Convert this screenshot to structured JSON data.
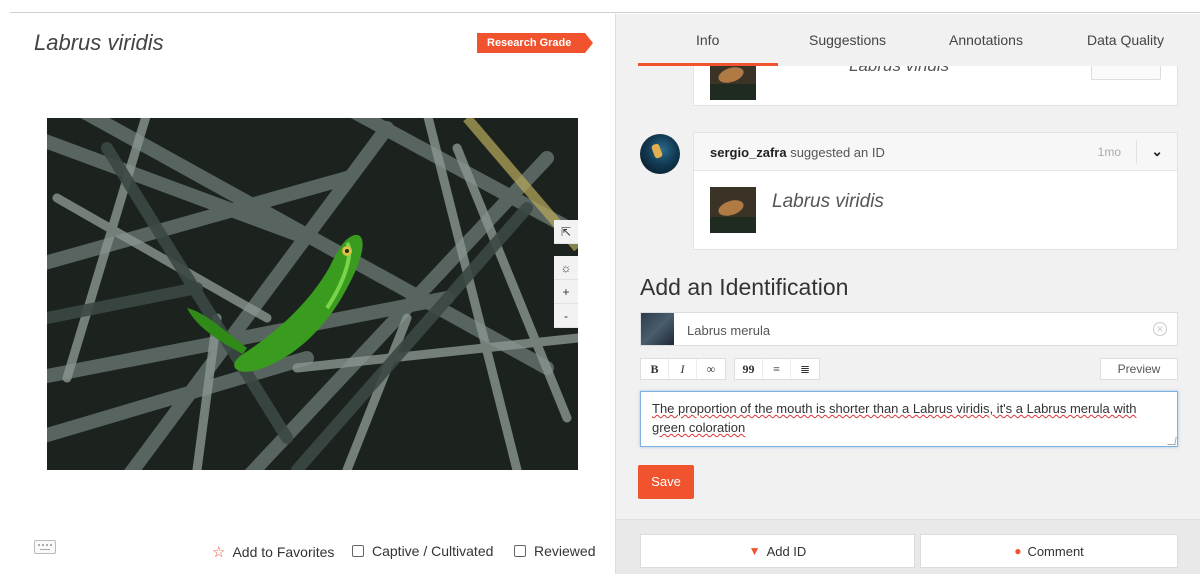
{
  "observation": {
    "title": "Labrus viridis",
    "quality_badge": "Research Grade"
  },
  "photo_tools": {
    "external_link_icon": "external-link-icon",
    "brightness_icon": "brightness-icon",
    "zoom_in": "+",
    "zoom_out": "-"
  },
  "left_footer": {
    "favorites_label": "Add to Favorites",
    "captive_label": "Captive / Cultivated",
    "reviewed_label": "Reviewed"
  },
  "tabs": [
    {
      "label": "Info"
    },
    {
      "label": "Suggestions"
    },
    {
      "label": "Annotations"
    },
    {
      "label": "Data Quality"
    }
  ],
  "previous_card": {
    "taxon": "Labrus viridis"
  },
  "identification": {
    "user": "sergio_zafra",
    "action": " suggested an ID",
    "time": "1mo",
    "taxon": "Labrus viridis"
  },
  "add_identification": {
    "title": "Add an Identification",
    "taxon_value": "Labrus merula",
    "toolbar": {
      "bold": "B",
      "italic": "I",
      "link": "∞",
      "quote": "99",
      "ul": "≡",
      "ol": "≣"
    },
    "preview_label": "Preview",
    "remarks": "The proportion of the mouth is shorter than a Labrus viridis, it's a Labrus merula with green coloration",
    "save_label": "Save"
  },
  "bottom_actions": {
    "add_id_label": "Add ID",
    "comment_label": "Comment"
  },
  "colors": {
    "accent": "#f0532d",
    "panel": "#f1f1f1",
    "focus": "#7fb1e0"
  }
}
